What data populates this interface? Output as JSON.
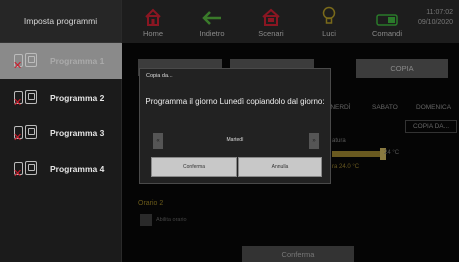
{
  "sidebar": {
    "title": "Imposta programmi",
    "items": [
      {
        "label": "Programma 1"
      },
      {
        "label": "Programma 2"
      },
      {
        "label": "Programma 3"
      },
      {
        "label": "Programma 4"
      }
    ]
  },
  "topbar": {
    "nav": [
      {
        "label": "Home",
        "icon": "home-icon"
      },
      {
        "label": "Indietro",
        "icon": "back-arrow-icon"
      },
      {
        "label": "Scenari",
        "icon": "scenes-icon"
      },
      {
        "label": "Luci",
        "icon": "bulb-icon"
      },
      {
        "label": "Comandi",
        "icon": "toggle-icon"
      }
    ],
    "time": "11:07:02",
    "date": "09/10/2020"
  },
  "main": {
    "copia_label": "COPIA",
    "days": [
      "ENERDÌ",
      "SABATO",
      "DOMENICA"
    ],
    "copia_da_label": "COPIA DA...",
    "temp_value": "24 °C",
    "temp_label": "ra 24.0 °C",
    "temp_prefix": "atura",
    "orario2": "Orario 2",
    "abilita": "Abilita orario",
    "conferma": "Conferma"
  },
  "dialog": {
    "title": "Copia da...",
    "message": "Programma il giorno Lunedì copiandolo dal giorno:",
    "selected_day": "Martedì",
    "prev_symbol": "«",
    "next_symbol": "»",
    "confirm_label": "Conferma",
    "cancel_label": "Annulla"
  },
  "colors": {
    "accent_red": "#cc1c2c",
    "accent_yellow": "#e3c020",
    "accent_green": "#3fb04a"
  }
}
